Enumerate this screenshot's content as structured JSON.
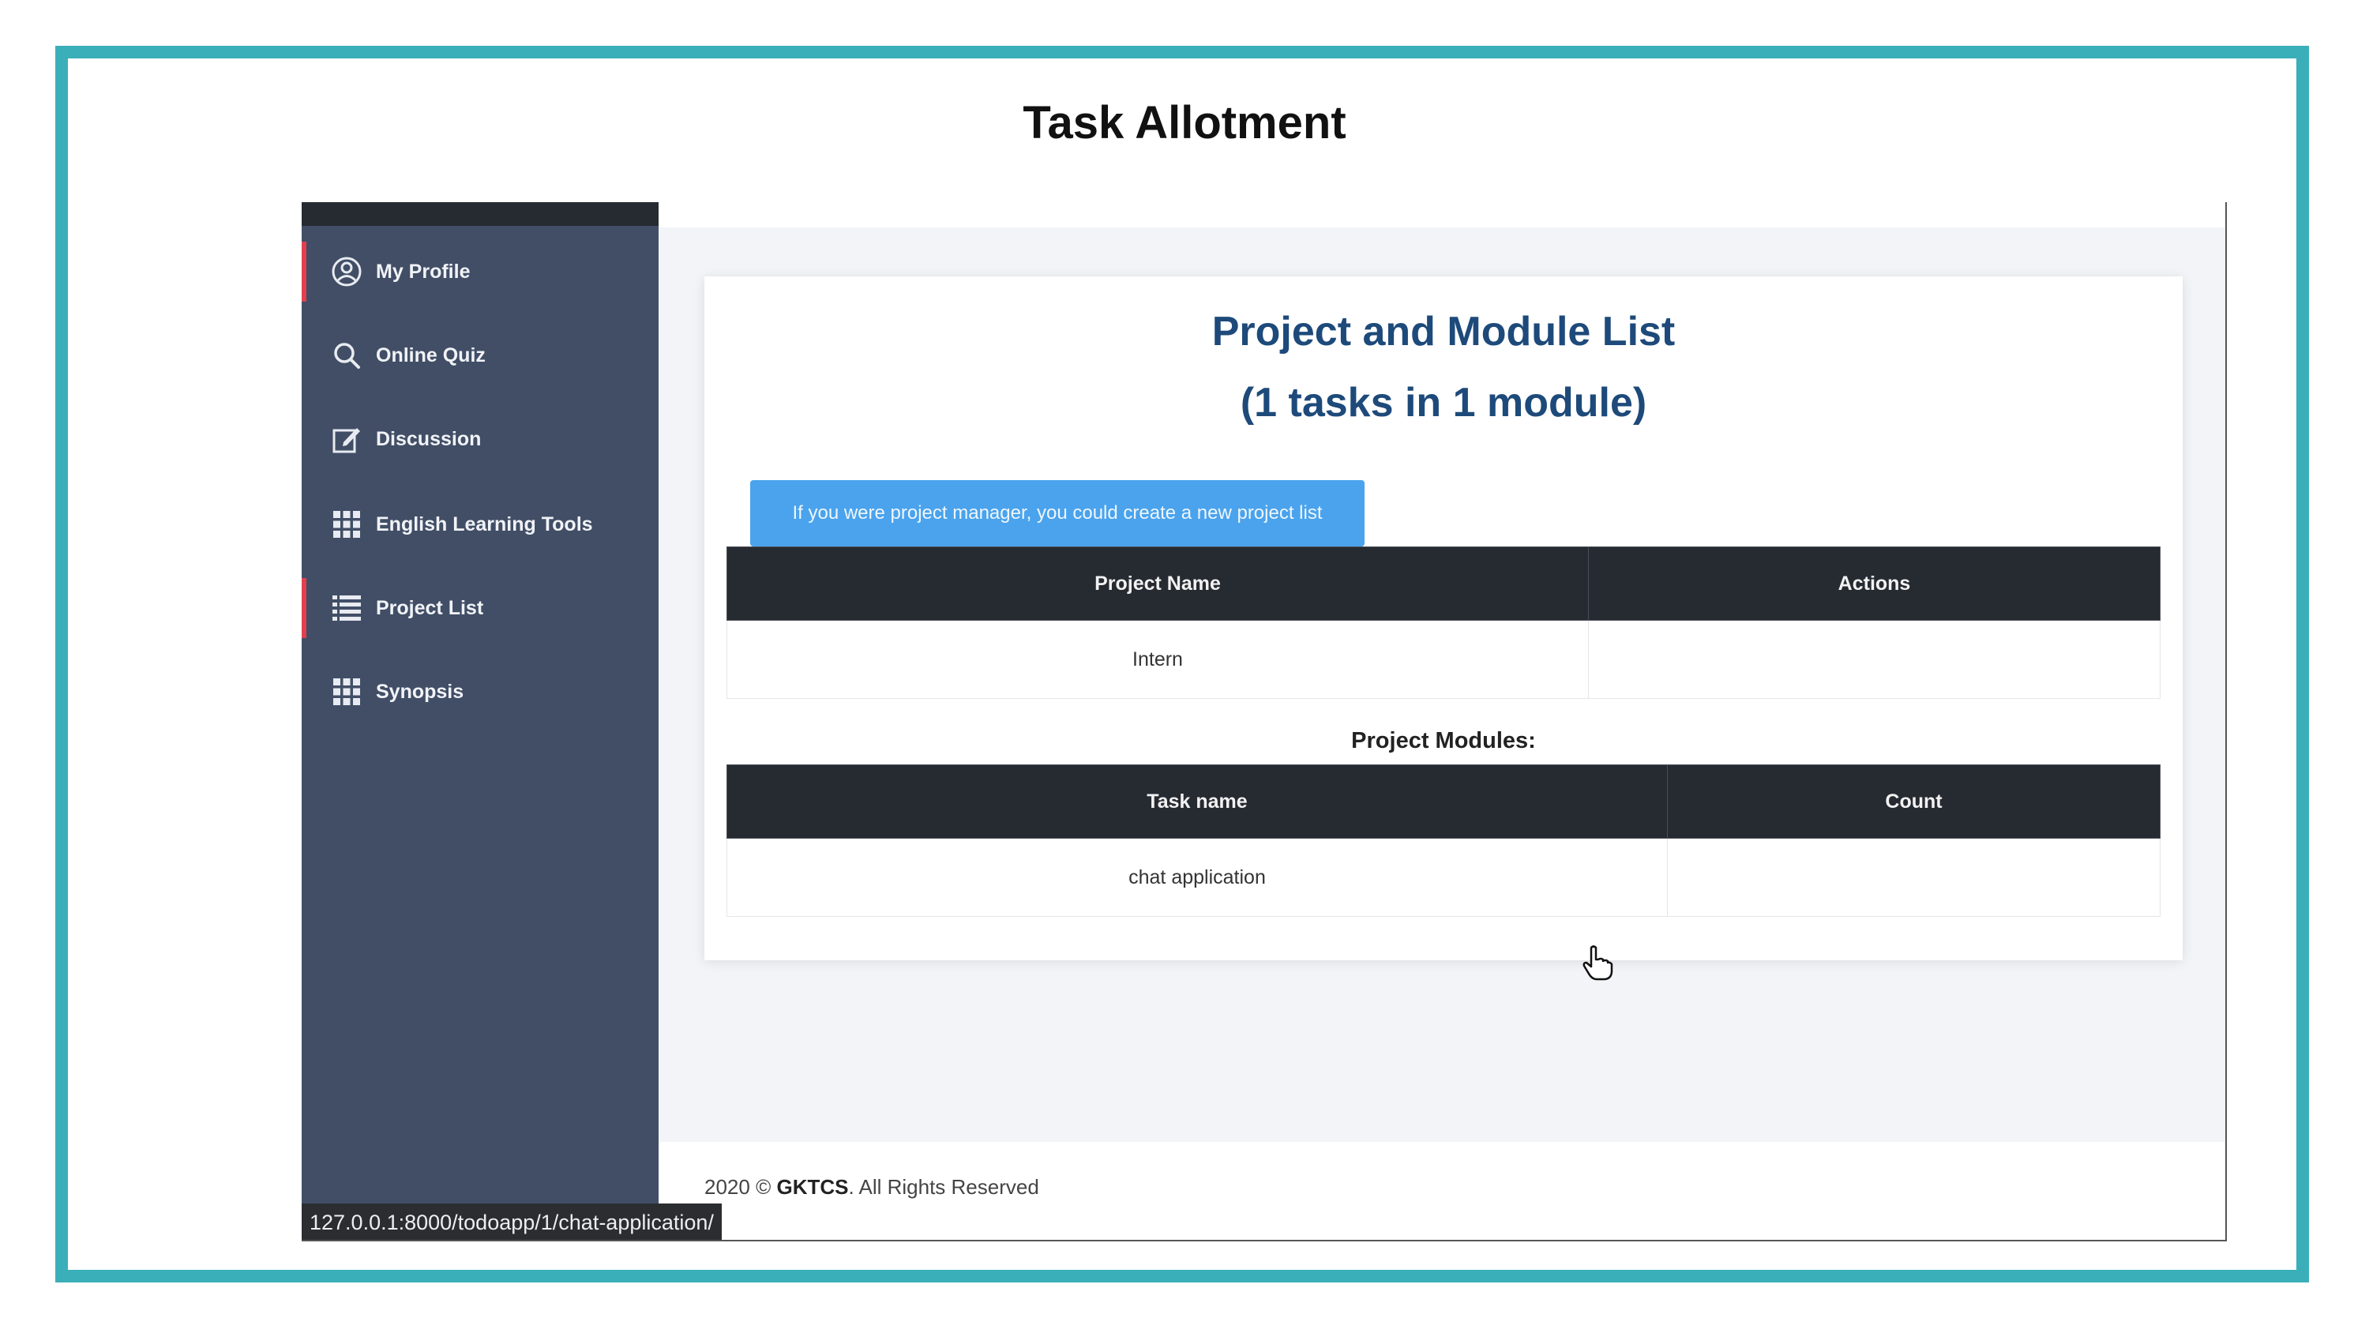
{
  "slide": {
    "title": "Task Allotment"
  },
  "colors": {
    "frame": "#3aafb9",
    "sidebar": "#414e66",
    "accent": "#e2404f",
    "heading": "#1d4a7a",
    "info_button": "#4aa3ec",
    "table_header": "#262a31"
  },
  "sidebar": {
    "items": [
      {
        "label": "My Profile",
        "icon": "user-circle-icon",
        "active": true
      },
      {
        "label": "Online Quiz",
        "icon": "search-icon",
        "active": false
      },
      {
        "label": "Discussion",
        "icon": "edit-icon",
        "active": false
      },
      {
        "label": "English Learning Tools",
        "icon": "grid-icon",
        "active": false
      },
      {
        "label": "Project List",
        "icon": "list-icon",
        "active": true
      },
      {
        "label": "Synopsis",
        "icon": "grid-icon",
        "active": false
      }
    ]
  },
  "main": {
    "title_line1": "Project and Module List",
    "title_line2": "(1 tasks in 1 module)",
    "info_button": "If you were project manager, you could create a new project list",
    "projects_table": {
      "headers": [
        "Project Name",
        "Actions"
      ],
      "rows": [
        [
          "Intern",
          ""
        ]
      ]
    },
    "modules_label": "Project Modules:",
    "modules_table": {
      "headers": [
        "Task name",
        "Count"
      ],
      "rows": [
        [
          "chat application",
          ""
        ]
      ]
    }
  },
  "footer": {
    "year": "2020 ©",
    "brand": "GKTCS",
    "suffix": ". All Rights Reserved"
  },
  "statusbar": {
    "url": "127.0.0.1:8000/todoapp/1/chat-application/"
  }
}
